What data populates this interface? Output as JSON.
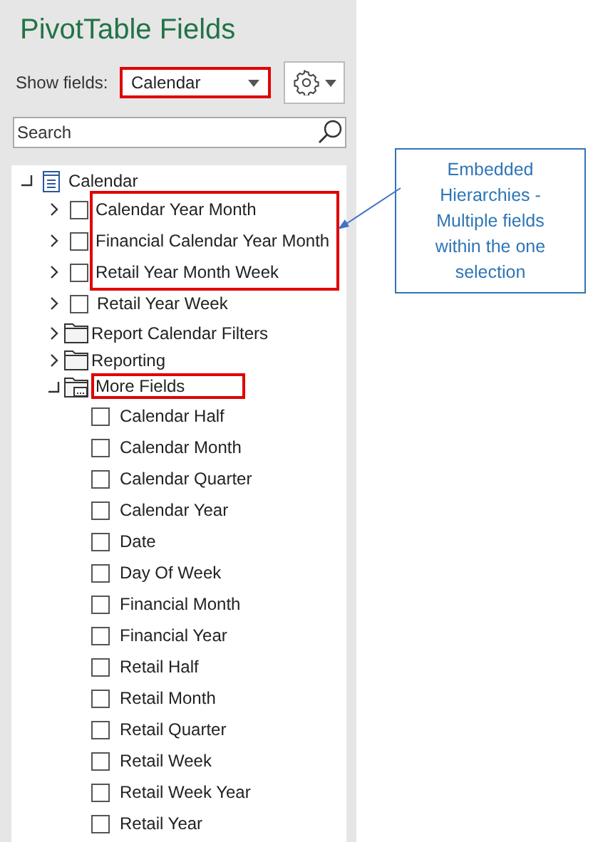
{
  "title": "PivotTable Fields",
  "show_fields": {
    "label": "Show fields:",
    "value": "Calendar",
    "highlighted": true
  },
  "search": {
    "placeholder": "Search"
  },
  "tree": {
    "label": "Calendar",
    "expanded": true,
    "children": [
      {
        "kind": "hierarchy",
        "label": "Calendar Year Month",
        "checked": false,
        "expanded": false,
        "highlighted": true
      },
      {
        "kind": "hierarchy",
        "label": "Financial Calendar Year Month",
        "checked": false,
        "expanded": false,
        "highlighted": true
      },
      {
        "kind": "hierarchy",
        "label": "Retail Year Month Week",
        "checked": false,
        "expanded": false,
        "highlighted": true
      },
      {
        "kind": "hierarchy",
        "label": "Retail Year Week",
        "checked": false,
        "expanded": false,
        "highlighted": false
      },
      {
        "kind": "folder",
        "label": "Report Calendar Filters",
        "expanded": false,
        "highlighted": false
      },
      {
        "kind": "folder",
        "label": "Reporting",
        "expanded": false,
        "highlighted": false
      },
      {
        "kind": "folder",
        "label": "More Fields",
        "expanded": true,
        "highlighted": true,
        "children": [
          {
            "label": "Calendar Half",
            "checked": false
          },
          {
            "label": "Calendar Month",
            "checked": false
          },
          {
            "label": "Calendar Quarter",
            "checked": false
          },
          {
            "label": "Calendar Year",
            "checked": false
          },
          {
            "label": "Date",
            "checked": false
          },
          {
            "label": "Day Of Week",
            "checked": false
          },
          {
            "label": "Financial Month",
            "checked": false
          },
          {
            "label": "Financial Year",
            "checked": false
          },
          {
            "label": "Retail Half",
            "checked": false
          },
          {
            "label": "Retail Month",
            "checked": false
          },
          {
            "label": "Retail Quarter",
            "checked": false
          },
          {
            "label": "Retail Week",
            "checked": false
          },
          {
            "label": "Retail Week Year",
            "checked": false
          },
          {
            "label": "Retail Year",
            "checked": false
          }
        ]
      }
    ]
  },
  "callout": {
    "text": "Embedded Hierarchies - Multiple fields within the one selection"
  }
}
